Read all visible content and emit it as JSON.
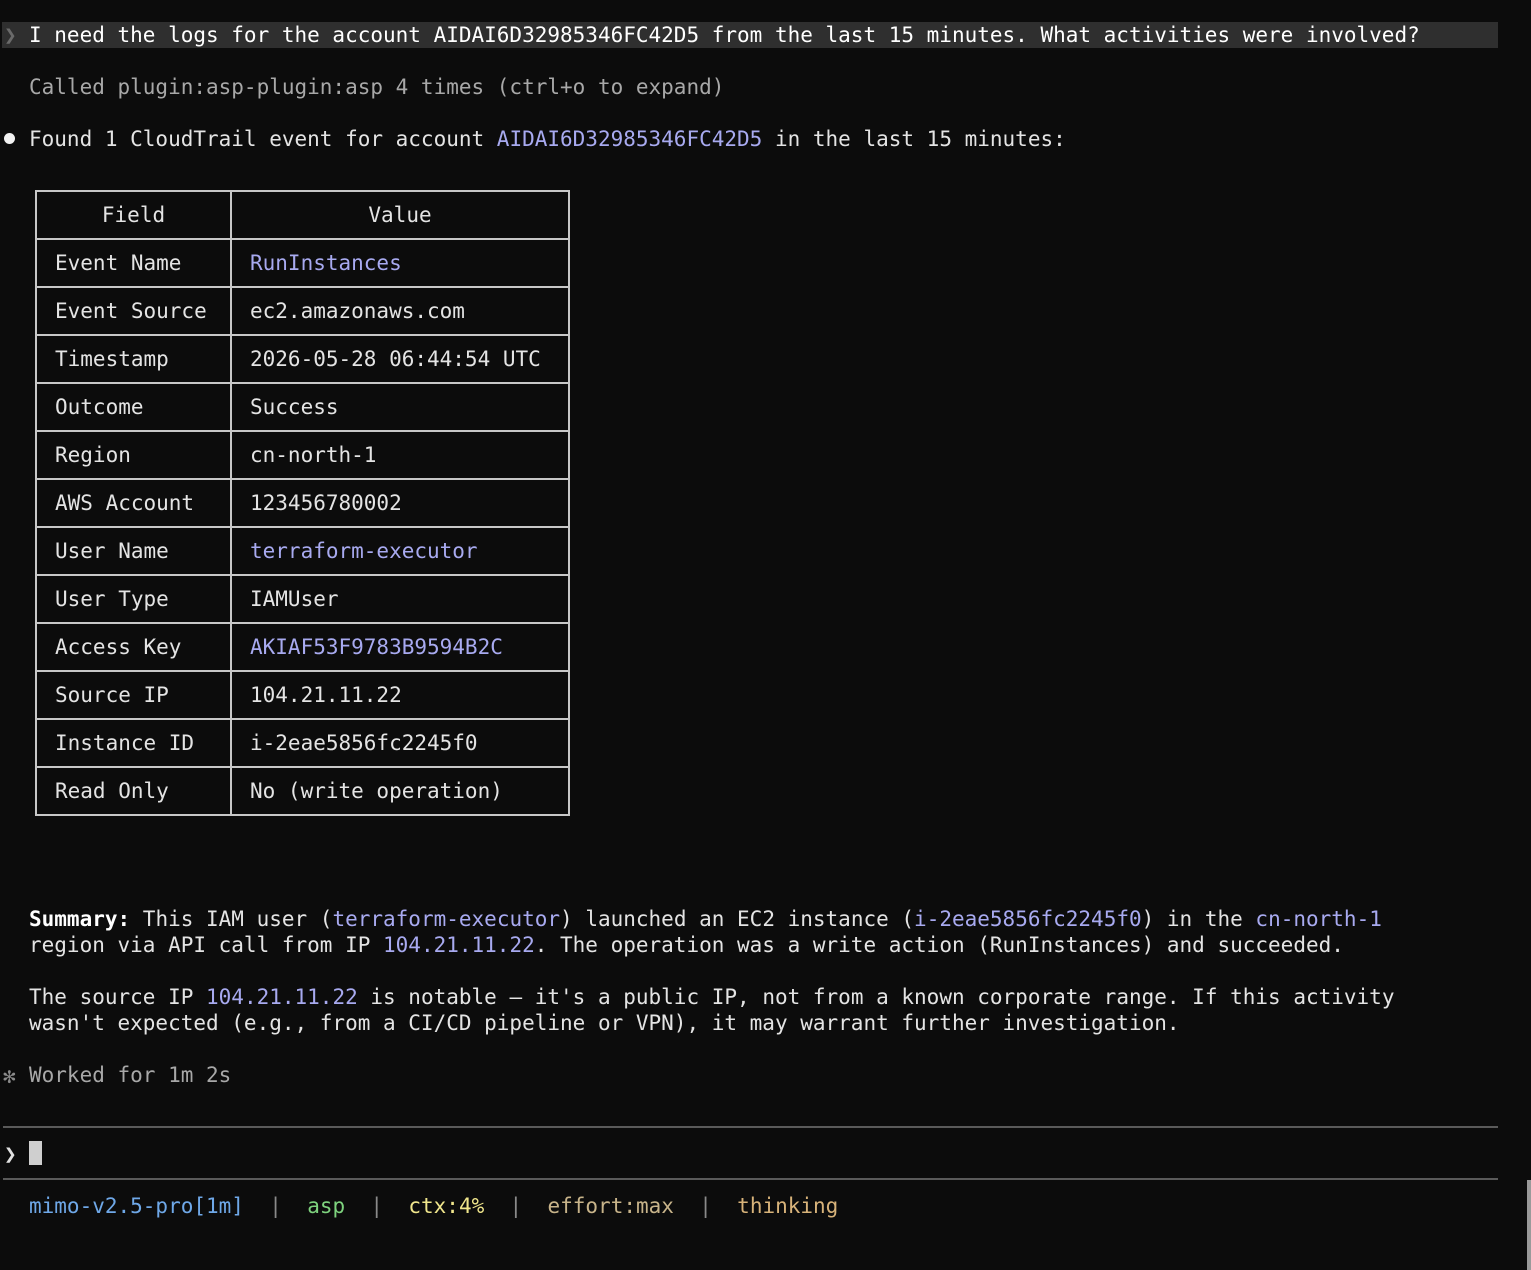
{
  "user_message": "I need the logs for the account AIDAI6D32985346FC42D5 from the last 15 minutes. What activities were involved?",
  "prompt_chevron": "❯",
  "tool_call_note": "Called plugin:asp-plugin:asp 4 times (ctrl+o to expand)",
  "found": {
    "prefix": "Found 1 CloudTrail event for account ",
    "account": "AIDAI6D32985346FC42D5",
    "suffix": " in the last 15 minutes:"
  },
  "table": {
    "headers": [
      "Field",
      "Value"
    ],
    "rows": [
      {
        "field": "Event Name",
        "value": "RunInstances",
        "highlight": true
      },
      {
        "field": "Event Source",
        "value": "ec2.amazonaws.com",
        "highlight": false
      },
      {
        "field": "Timestamp",
        "value": "2026-05-28 06:44:54 UTC",
        "highlight": false
      },
      {
        "field": "Outcome",
        "value": "Success",
        "highlight": false
      },
      {
        "field": "Region",
        "value": "cn-north-1",
        "highlight": false
      },
      {
        "field": "AWS Account",
        "value": "123456780002",
        "highlight": false
      },
      {
        "field": "User Name",
        "value": "terraform-executor",
        "highlight": true
      },
      {
        "field": "User Type",
        "value": "IAMUser",
        "highlight": false
      },
      {
        "field": "Access Key",
        "value": "AKIAF53F9783B9594B2C",
        "highlight": true
      },
      {
        "field": "Source IP",
        "value": "104.21.11.22",
        "highlight": false
      },
      {
        "field": "Instance ID",
        "value": "i-2eae5856fc2245f0",
        "highlight": false
      },
      {
        "field": "Read Only",
        "value": "No (write operation)",
        "highlight": false
      }
    ]
  },
  "summary": {
    "label": "Summary:",
    "t1": " This IAM user (",
    "user": "terraform-executor",
    "t2": ") launched an EC2 instance (",
    "instance": "i-2eae5856fc2245f0",
    "t3": ") in the ",
    "region": "cn-north-1",
    "t4": "region via API call from IP ",
    "ip": "104.21.11.22",
    "t5": ". The operation was a write action (RunInstances) and succeeded."
  },
  "note": {
    "t1": "The source IP ",
    "ip": "104.21.11.22",
    "t2": " is notable — it's a public IP, not from a known corporate range. If this activity",
    "t3": "wasn't expected (e.g., from a CI/CD pipeline or VPN), it may warrant further investigation."
  },
  "worked": {
    "icon": "✻",
    "text": "Worked for 1m 2s"
  },
  "input_chevron": "❯",
  "status": {
    "model": "mimo-v2.5-pro[1m]",
    "plugin": "asp",
    "ctx": "ctx:4%",
    "effort": "effort:max",
    "thinking": "thinking",
    "separator": "|"
  },
  "colors": {
    "background": "#0c0c0c",
    "highlight": "#a8aaf0",
    "model": "#6fa8e8",
    "plugin": "#7ed37e",
    "ctx": "#f0e68c"
  }
}
